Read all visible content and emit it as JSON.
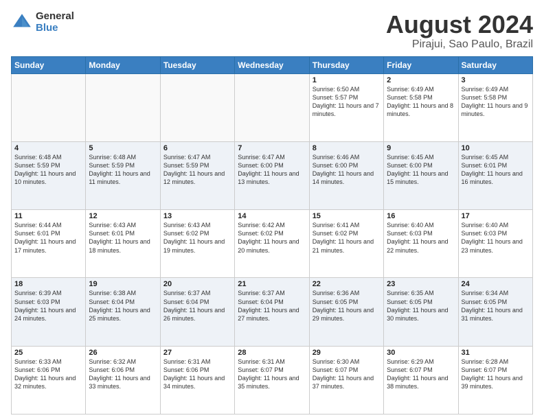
{
  "logo": {
    "general": "General",
    "blue": "Blue"
  },
  "title": "August 2024",
  "location": "Pirajui, Sao Paulo, Brazil",
  "days_of_week": [
    "Sunday",
    "Monday",
    "Tuesday",
    "Wednesday",
    "Thursday",
    "Friday",
    "Saturday"
  ],
  "weeks": [
    [
      {
        "day": "",
        "sunrise": "",
        "sunset": "",
        "daylight": ""
      },
      {
        "day": "",
        "sunrise": "",
        "sunset": "",
        "daylight": ""
      },
      {
        "day": "",
        "sunrise": "",
        "sunset": "",
        "daylight": ""
      },
      {
        "day": "",
        "sunrise": "",
        "sunset": "",
        "daylight": ""
      },
      {
        "day": "1",
        "sunrise": "Sunrise: 6:50 AM",
        "sunset": "Sunset: 5:57 PM",
        "daylight": "Daylight: 11 hours and 7 minutes."
      },
      {
        "day": "2",
        "sunrise": "Sunrise: 6:49 AM",
        "sunset": "Sunset: 5:58 PM",
        "daylight": "Daylight: 11 hours and 8 minutes."
      },
      {
        "day": "3",
        "sunrise": "Sunrise: 6:49 AM",
        "sunset": "Sunset: 5:58 PM",
        "daylight": "Daylight: 11 hours and 9 minutes."
      }
    ],
    [
      {
        "day": "4",
        "sunrise": "Sunrise: 6:48 AM",
        "sunset": "Sunset: 5:59 PM",
        "daylight": "Daylight: 11 hours and 10 minutes."
      },
      {
        "day": "5",
        "sunrise": "Sunrise: 6:48 AM",
        "sunset": "Sunset: 5:59 PM",
        "daylight": "Daylight: 11 hours and 11 minutes."
      },
      {
        "day": "6",
        "sunrise": "Sunrise: 6:47 AM",
        "sunset": "Sunset: 5:59 PM",
        "daylight": "Daylight: 11 hours and 12 minutes."
      },
      {
        "day": "7",
        "sunrise": "Sunrise: 6:47 AM",
        "sunset": "Sunset: 6:00 PM",
        "daylight": "Daylight: 11 hours and 13 minutes."
      },
      {
        "day": "8",
        "sunrise": "Sunrise: 6:46 AM",
        "sunset": "Sunset: 6:00 PM",
        "daylight": "Daylight: 11 hours and 14 minutes."
      },
      {
        "day": "9",
        "sunrise": "Sunrise: 6:45 AM",
        "sunset": "Sunset: 6:00 PM",
        "daylight": "Daylight: 11 hours and 15 minutes."
      },
      {
        "day": "10",
        "sunrise": "Sunrise: 6:45 AM",
        "sunset": "Sunset: 6:01 PM",
        "daylight": "Daylight: 11 hours and 16 minutes."
      }
    ],
    [
      {
        "day": "11",
        "sunrise": "Sunrise: 6:44 AM",
        "sunset": "Sunset: 6:01 PM",
        "daylight": "Daylight: 11 hours and 17 minutes."
      },
      {
        "day": "12",
        "sunrise": "Sunrise: 6:43 AM",
        "sunset": "Sunset: 6:01 PM",
        "daylight": "Daylight: 11 hours and 18 minutes."
      },
      {
        "day": "13",
        "sunrise": "Sunrise: 6:43 AM",
        "sunset": "Sunset: 6:02 PM",
        "daylight": "Daylight: 11 hours and 19 minutes."
      },
      {
        "day": "14",
        "sunrise": "Sunrise: 6:42 AM",
        "sunset": "Sunset: 6:02 PM",
        "daylight": "Daylight: 11 hours and 20 minutes."
      },
      {
        "day": "15",
        "sunrise": "Sunrise: 6:41 AM",
        "sunset": "Sunset: 6:02 PM",
        "daylight": "Daylight: 11 hours and 21 minutes."
      },
      {
        "day": "16",
        "sunrise": "Sunrise: 6:40 AM",
        "sunset": "Sunset: 6:03 PM",
        "daylight": "Daylight: 11 hours and 22 minutes."
      },
      {
        "day": "17",
        "sunrise": "Sunrise: 6:40 AM",
        "sunset": "Sunset: 6:03 PM",
        "daylight": "Daylight: 11 hours and 23 minutes."
      }
    ],
    [
      {
        "day": "18",
        "sunrise": "Sunrise: 6:39 AM",
        "sunset": "Sunset: 6:03 PM",
        "daylight": "Daylight: 11 hours and 24 minutes."
      },
      {
        "day": "19",
        "sunrise": "Sunrise: 6:38 AM",
        "sunset": "Sunset: 6:04 PM",
        "daylight": "Daylight: 11 hours and 25 minutes."
      },
      {
        "day": "20",
        "sunrise": "Sunrise: 6:37 AM",
        "sunset": "Sunset: 6:04 PM",
        "daylight": "Daylight: 11 hours and 26 minutes."
      },
      {
        "day": "21",
        "sunrise": "Sunrise: 6:37 AM",
        "sunset": "Sunset: 6:04 PM",
        "daylight": "Daylight: 11 hours and 27 minutes."
      },
      {
        "day": "22",
        "sunrise": "Sunrise: 6:36 AM",
        "sunset": "Sunset: 6:05 PM",
        "daylight": "Daylight: 11 hours and 29 minutes."
      },
      {
        "day": "23",
        "sunrise": "Sunrise: 6:35 AM",
        "sunset": "Sunset: 6:05 PM",
        "daylight": "Daylight: 11 hours and 30 minutes."
      },
      {
        "day": "24",
        "sunrise": "Sunrise: 6:34 AM",
        "sunset": "Sunset: 6:05 PM",
        "daylight": "Daylight: 11 hours and 31 minutes."
      }
    ],
    [
      {
        "day": "25",
        "sunrise": "Sunrise: 6:33 AM",
        "sunset": "Sunset: 6:06 PM",
        "daylight": "Daylight: 11 hours and 32 minutes."
      },
      {
        "day": "26",
        "sunrise": "Sunrise: 6:32 AM",
        "sunset": "Sunset: 6:06 PM",
        "daylight": "Daylight: 11 hours and 33 minutes."
      },
      {
        "day": "27",
        "sunrise": "Sunrise: 6:31 AM",
        "sunset": "Sunset: 6:06 PM",
        "daylight": "Daylight: 11 hours and 34 minutes."
      },
      {
        "day": "28",
        "sunrise": "Sunrise: 6:31 AM",
        "sunset": "Sunset: 6:07 PM",
        "daylight": "Daylight: 11 hours and 35 minutes."
      },
      {
        "day": "29",
        "sunrise": "Sunrise: 6:30 AM",
        "sunset": "Sunset: 6:07 PM",
        "daylight": "Daylight: 11 hours and 37 minutes."
      },
      {
        "day": "30",
        "sunrise": "Sunrise: 6:29 AM",
        "sunset": "Sunset: 6:07 PM",
        "daylight": "Daylight: 11 hours and 38 minutes."
      },
      {
        "day": "31",
        "sunrise": "Sunrise: 6:28 AM",
        "sunset": "Sunset: 6:07 PM",
        "daylight": "Daylight: 11 hours and 39 minutes."
      }
    ]
  ]
}
